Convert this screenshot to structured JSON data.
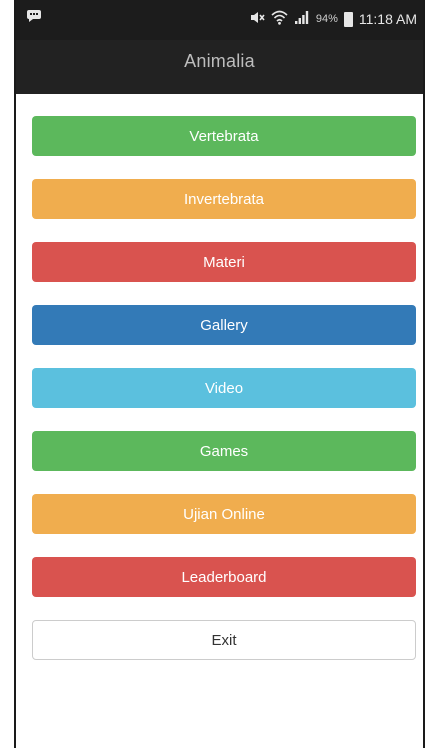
{
  "status_bar": {
    "notification_icon": "chat-bubble-icon",
    "mute_icon": "mute-icon",
    "wifi_icon": "wifi-icon",
    "signal_icon": "signal-icon",
    "battery_percent": "94%",
    "time": "11:18 AM"
  },
  "app_bar": {
    "title": "Animalia"
  },
  "menu": {
    "items": [
      {
        "label": "Vertebrata",
        "color": "#5cb85c"
      },
      {
        "label": "Invertebrata",
        "color": "#f0ad4e"
      },
      {
        "label": "Materi",
        "color": "#d9534f"
      },
      {
        "label": "Gallery",
        "color": "#337ab7"
      },
      {
        "label": "Video",
        "color": "#5bc0de"
      },
      {
        "label": "Games",
        "color": "#5cb85c"
      },
      {
        "label": "Ujian Online",
        "color": "#f0ad4e"
      },
      {
        "label": "Leaderboard",
        "color": "#d9534f"
      },
      {
        "label": "Exit",
        "color": "#ffffff"
      }
    ]
  }
}
